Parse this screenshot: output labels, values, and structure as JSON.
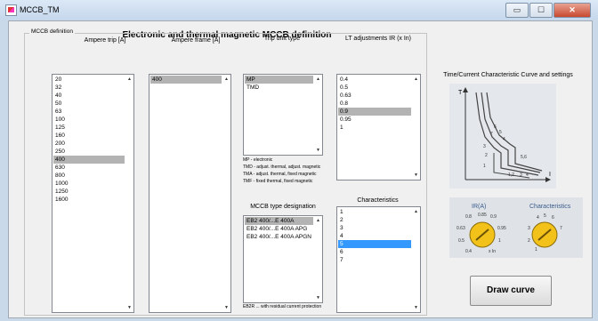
{
  "window": {
    "title": "MCCB_TM",
    "minimize": "▭",
    "maximize": "☐",
    "close": "✕"
  },
  "main_title": "Electronic and thermal magnetic MCCB definition",
  "group_label": "MCCB definition",
  "ampere_trip": {
    "label": "Ampere trip [A]",
    "items": [
      "20",
      "32",
      "40",
      "50",
      "63",
      "100",
      "125",
      "160",
      "200",
      "250",
      "400",
      "630",
      "800",
      "1000",
      "1250",
      "1600"
    ],
    "selected": "400"
  },
  "ampere_frame": {
    "label": "Ampere frame [A]",
    "items": [
      "400"
    ],
    "selected": "400"
  },
  "trip_unit": {
    "label": "Trip unit type",
    "items": [
      "MP",
      "TMD"
    ],
    "selected": "MP",
    "notes": [
      "MP - electronic",
      "TMD - adjust. thermal, adjust. magnetic",
      "TMA - adjust. thermal, fixed magnetic",
      "TMF - fixed thermal, fixed magnetic"
    ]
  },
  "lt_adjustments": {
    "label": "LT adjustments IR (x In)",
    "items": [
      "0.4",
      "0.5",
      "0.63",
      "0.8",
      "0.9",
      "0.95",
      "1"
    ],
    "selected": "0.9"
  },
  "mccb_type": {
    "label": "MCCB type designation",
    "items": [
      "EB2 400/...E 400A",
      "EB2 400/...E 400A APG",
      "EB2 400/...E 400A APGN"
    ],
    "selected": "EB2 400/...E 400A",
    "note": "EB2R ... with residual current protection"
  },
  "characteristics": {
    "label": "Characteristics",
    "items": [
      "1",
      "2",
      "3",
      "4",
      "5",
      "6",
      "7"
    ],
    "selected": "5"
  },
  "curve_panel": {
    "title": "Time/Current Characteristic Curve and settings",
    "axis_t": "T",
    "axis_i": "I",
    "curve_labels": [
      "7",
      "6",
      "5",
      "4",
      "3",
      "2",
      "1",
      "5,6",
      "1,2",
      "3",
      "4"
    ],
    "dial_ir_label": "IR(A)",
    "dial_ir_marks": [
      "0.8",
      "0.85",
      "0.9",
      "0.63",
      "0.95",
      "0.5",
      "1",
      "0.4",
      "x In"
    ],
    "dial_char_label": "Characteristics",
    "dial_char_marks": [
      "4",
      "5",
      "6",
      "3",
      "7",
      "2",
      "1"
    ]
  },
  "draw_button": "Draw curve"
}
